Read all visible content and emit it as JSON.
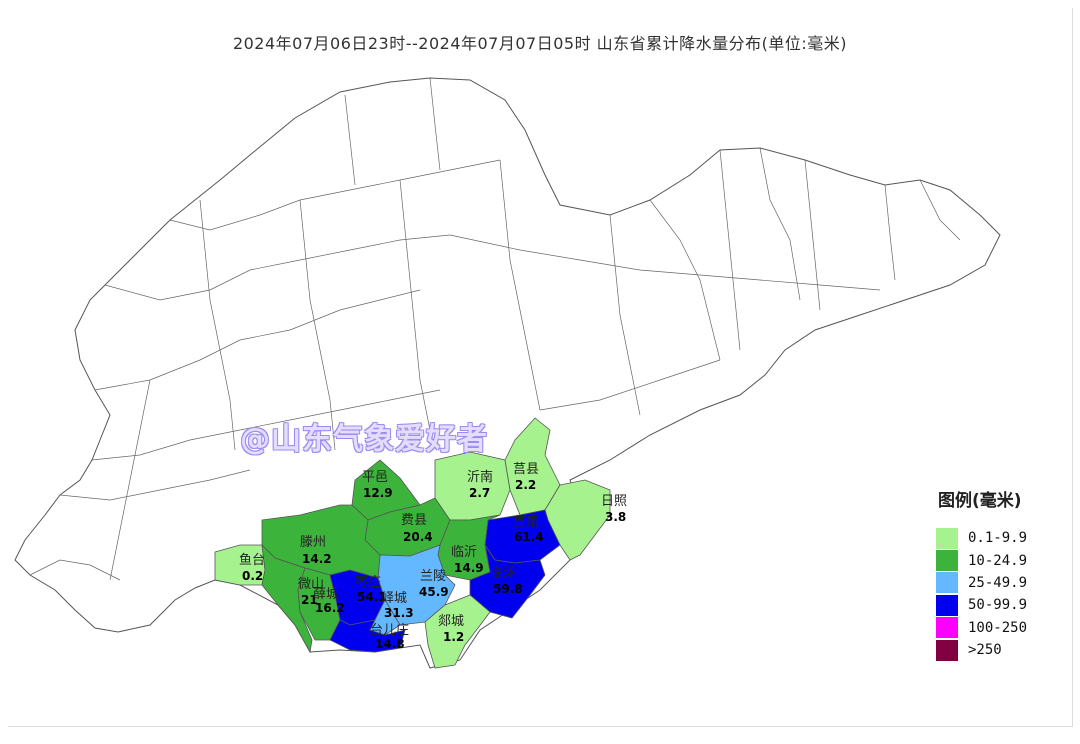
{
  "title": "2024年07月06日23时--2024年07月07日05时 山东省累计降水量分布(单位:毫米)",
  "watermark": "@山东气象爱好者",
  "legend": {
    "title": "图例(毫米)",
    "items": [
      {
        "label": "0.1-9.9",
        "color": "#a6f28e"
      },
      {
        "label": "10-24.9",
        "color": "#3cb43c"
      },
      {
        "label": "25-49.9",
        "color": "#63b8ff"
      },
      {
        "label": "50-99.9",
        "color": "#0000ee"
      },
      {
        "label": "100-250",
        "color": "#ff00ff"
      },
      {
        "label": ">250",
        "color": "#800040"
      }
    ]
  },
  "counties": [
    {
      "name": "平邑",
      "value": "12.9",
      "color": "#3cb43c"
    },
    {
      "name": "费县",
      "value": "20.4",
      "color": "#3cb43c"
    },
    {
      "name": "沂南",
      "value": "2.7",
      "color": "#a6f28e"
    },
    {
      "name": "莒县",
      "value": "2.2",
      "color": "#a6f28e"
    },
    {
      "name": "日照",
      "value": "3.8",
      "color": "#a6f28e"
    },
    {
      "name": "莒南",
      "value": "61.4",
      "color": "#0000ee"
    },
    {
      "name": "临沂",
      "value": "14.9",
      "color": "#3cb43c"
    },
    {
      "name": "临沭",
      "value": "59.8",
      "color": "#0000ee"
    },
    {
      "name": "兰陵",
      "value": "45.9",
      "color": "#63b8ff"
    },
    {
      "name": "郯城",
      "value": "1.2",
      "color": "#a6f28e"
    },
    {
      "name": "滕州",
      "value": "14.2",
      "color": "#3cb43c"
    },
    {
      "name": "鱼台",
      "value": "0.2",
      "color": "#a6f28e"
    },
    {
      "name": "微山",
      "value": "21",
      "color": "#3cb43c"
    },
    {
      "name": "薛城",
      "value": "16.2",
      "color": "#3cb43c"
    },
    {
      "name": "枣庄",
      "value": "54.1",
      "color": "#0000ee"
    },
    {
      "name": "峄城",
      "value": "31.3",
      "color": "#63b8ff"
    },
    {
      "name": "台儿庄",
      "value": "14.8",
      "color": "#0000ee"
    }
  ]
}
